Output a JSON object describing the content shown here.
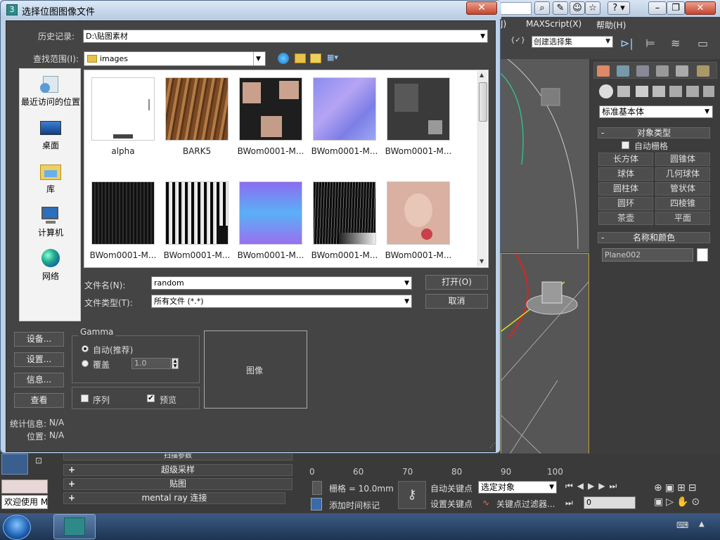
{
  "dialog": {
    "title": "选择位图图像文件",
    "history_label": "历史记录:",
    "history_value": "D:\\贴图素材",
    "lookin_label": "查找范围(I):",
    "lookin_value": "images",
    "close_glyph": "✕",
    "places": [
      {
        "label": "最近访问的位置",
        "icon": "recent-places-icon"
      },
      {
        "label": "桌面",
        "icon": "desktop-icon"
      },
      {
        "label": "库",
        "icon": "libraries-icon"
      },
      {
        "label": "计算机",
        "icon": "computer-icon"
      },
      {
        "label": "网络",
        "icon": "network-icon"
      }
    ],
    "files": [
      {
        "name": "alpha"
      },
      {
        "name": "BARK5"
      },
      {
        "name": "BWom0001-M..."
      },
      {
        "name": "BWom0001-M..."
      },
      {
        "name": "BWom0001-M..."
      },
      {
        "name": "BWom0001-M..."
      },
      {
        "name": "BWom0001-M..."
      },
      {
        "name": "BWom0001-M..."
      },
      {
        "name": "BWom0001-M..."
      },
      {
        "name": "BWom0001-M..."
      }
    ],
    "filename_label": "文件名(N):",
    "filename_value": "random",
    "filetype_label": "文件类型(T):",
    "filetype_value": "所有文件 (*.*)",
    "open_button": "打开(O)",
    "cancel_button": "取消",
    "setup_button": "设备...",
    "settings_button": "设置...",
    "info_button": "信息...",
    "view_button": "查看",
    "gamma_title": "Gamma",
    "gamma_auto": "自动(推荐)",
    "gamma_override": "覆盖",
    "gamma_value": "1.0",
    "sequence_label": "序列",
    "preview_label": "预览",
    "preview_checked": "✔",
    "image_label": "图像",
    "stats_label": "统计信息:",
    "stats_value": "N/A",
    "location_label": "位置:",
    "location_value": "N/A"
  },
  "max": {
    "menu": [
      "J)",
      "MAXScript(X)",
      "帮助(H)"
    ],
    "selection_set": "创建选择集",
    "primitive_type": "标准基本体",
    "object_type_header": "对象类型",
    "autogrid": "自动栅格",
    "objects": [
      "长方体",
      "圆锥体",
      "球体",
      "几何球体",
      "圆柱体",
      "管状体",
      "圆环",
      "四棱锥",
      "茶壶",
      "平面"
    ],
    "name_color_header": "名称和颜色",
    "object_name": "Plane002",
    "rollouts": [
      "扫描参数",
      "超级采样",
      "贴图",
      "mental ray 连接"
    ],
    "ruler": [
      "0",
      "60",
      "70",
      "80",
      "90",
      "100"
    ],
    "grid": "栅格 = 10.0mm",
    "add_time_tag": "添加时间标记",
    "auto_key": "自动关键点",
    "set_key": "设置关键点",
    "selected_object": "选定对象",
    "key_filters": "关键点过滤器...",
    "frame": "0",
    "welcome": "欢迎使用 M",
    "help_glyph": "?"
  }
}
